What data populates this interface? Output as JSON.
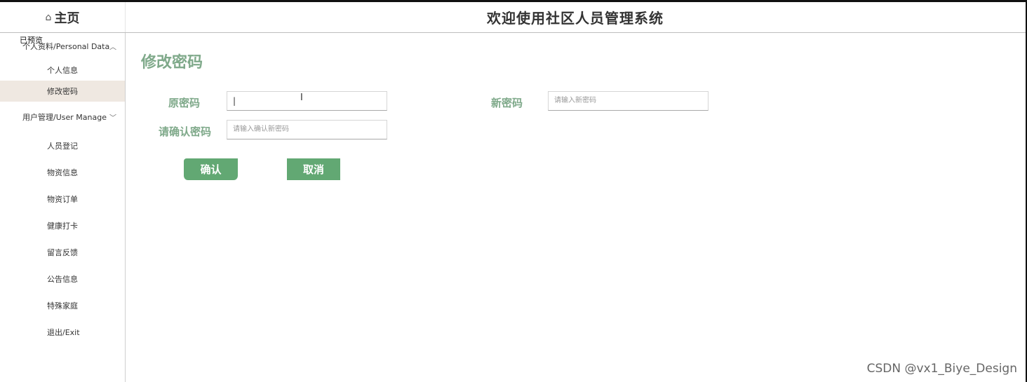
{
  "header": {
    "home_icon": "⌂",
    "brand": "主页",
    "title": "欢迎使用社区人员管理系统"
  },
  "sidebar": {
    "overlap_text": "已预览",
    "groups": [
      {
        "label": "个人资料/Personal Data",
        "chevron": "^",
        "items": [
          {
            "label": "个人信息"
          },
          {
            "label": "修改密码"
          }
        ]
      },
      {
        "label": "用户管理/User Manage",
        "chevron": "v",
        "items": [
          {
            "label": "人员登记"
          },
          {
            "label": "物资信息"
          },
          {
            "label": "物资订单"
          },
          {
            "label": "健康打卡"
          },
          {
            "label": "留言反馈"
          },
          {
            "label": "公告信息"
          },
          {
            "label": "特殊家庭"
          },
          {
            "label": "退出/Exit"
          }
        ]
      }
    ]
  },
  "main": {
    "title": "修改密码",
    "form": {
      "old_password_label": "原密码",
      "old_password_value": "",
      "new_password_label": "新密码",
      "new_password_placeholder": "请输入新密码",
      "confirm_label": "请确认密码",
      "confirm_placeholder": "请输入确认新密码"
    },
    "buttons": {
      "confirm": "确认",
      "cancel": "取消"
    }
  },
  "watermark": "CSDN @vx1_Biye_Design"
}
